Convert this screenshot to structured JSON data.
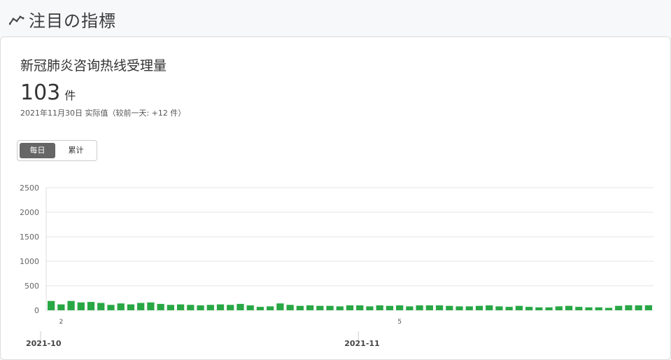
{
  "header": {
    "title": "注目の指標",
    "icon": "trend-line-icon"
  },
  "card": {
    "title": "新冠肺炎咨询热线受理量",
    "value": "103",
    "unit": "件",
    "subtitle": "2021年11月30日 实际值（较前一天: +12 件）"
  },
  "toggle": {
    "daily_label": "每日",
    "cumulative_label": "累计",
    "selected": "每日"
  },
  "colors": {
    "bar": "#28a745",
    "grid": "#e6e6e6"
  },
  "chart_data": {
    "type": "bar",
    "x": [
      "2021-10-01",
      "2021-10-02",
      "2021-10-03",
      "2021-10-04",
      "2021-10-05",
      "2021-10-06",
      "2021-10-07",
      "2021-10-08",
      "2021-10-09",
      "2021-10-10",
      "2021-10-11",
      "2021-10-12",
      "2021-10-13",
      "2021-10-14",
      "2021-10-15",
      "2021-10-16",
      "2021-10-17",
      "2021-10-18",
      "2021-10-19",
      "2021-10-20",
      "2021-10-21",
      "2021-10-22",
      "2021-10-23",
      "2021-10-24",
      "2021-10-25",
      "2021-10-26",
      "2021-10-27",
      "2021-10-28",
      "2021-10-29",
      "2021-10-30",
      "2021-10-31",
      "2021-11-01",
      "2021-11-02",
      "2021-11-03",
      "2021-11-04",
      "2021-11-05",
      "2021-11-06",
      "2021-11-07",
      "2021-11-08",
      "2021-11-09",
      "2021-11-10",
      "2021-11-11",
      "2021-11-12",
      "2021-11-13",
      "2021-11-14",
      "2021-11-15",
      "2021-11-16",
      "2021-11-17",
      "2021-11-18",
      "2021-11-19",
      "2021-11-20",
      "2021-11-21",
      "2021-11-22",
      "2021-11-23",
      "2021-11-24",
      "2021-11-25",
      "2021-11-26",
      "2021-11-27",
      "2021-11-28",
      "2021-11-29",
      "2021-11-30"
    ],
    "values": [
      190,
      120,
      190,
      160,
      170,
      150,
      110,
      140,
      120,
      150,
      160,
      130,
      110,
      120,
      110,
      100,
      110,
      120,
      110,
      130,
      100,
      70,
      80,
      140,
      110,
      90,
      100,
      90,
      90,
      80,
      100,
      100,
      80,
      100,
      90,
      100,
      80,
      100,
      100,
      100,
      90,
      80,
      80,
      90,
      100,
      80,
      70,
      90,
      70,
      60,
      60,
      80,
      90,
      70,
      60,
      60,
      50,
      90,
      103,
      100,
      103
    ],
    "ylim": [
      0,
      2500
    ],
    "yticks": [
      0,
      500,
      1000,
      1500,
      2000,
      2500
    ],
    "xtick_labels": [
      {
        "date": "2021-10-02",
        "label": "2"
      },
      {
        "date": "2021-11-05",
        "label": "5"
      }
    ],
    "month_labels": [
      {
        "date": "2021-10-01",
        "label": "2021-10"
      },
      {
        "date": "2021-11-01",
        "label": "2021-11"
      }
    ],
    "grid": true
  }
}
